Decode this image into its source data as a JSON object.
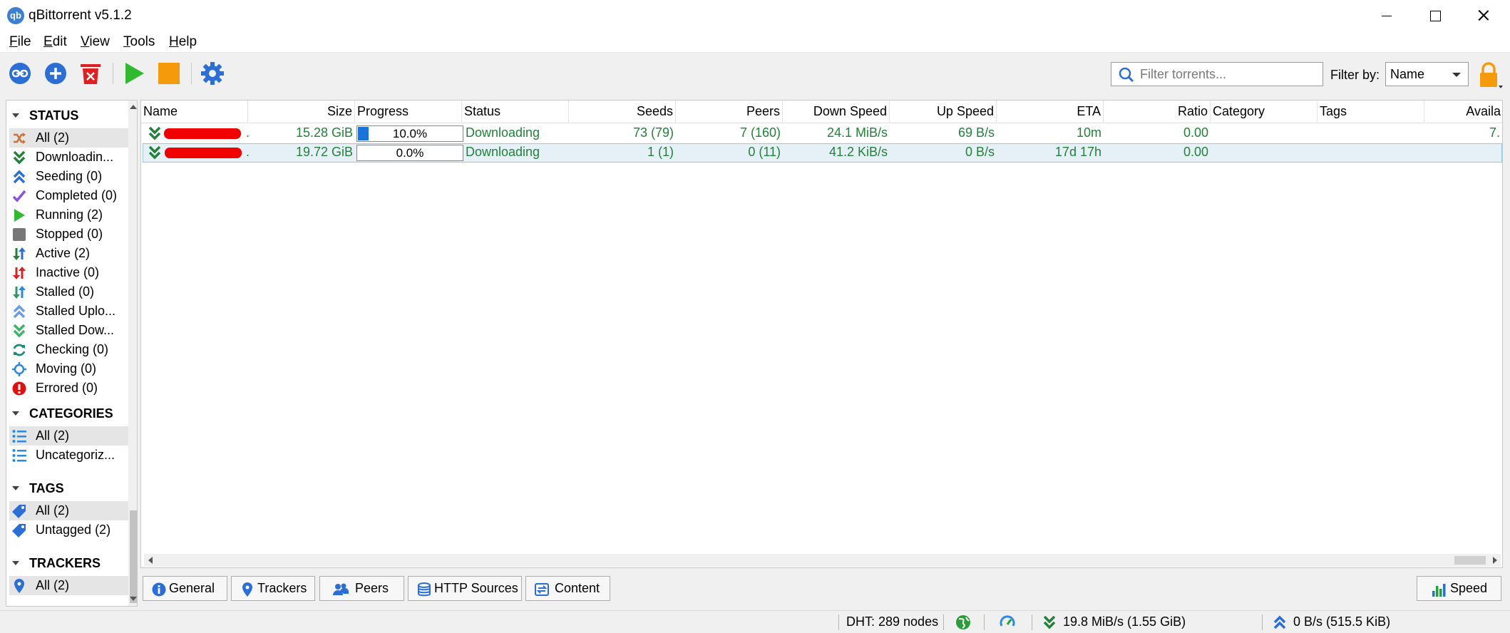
{
  "window": {
    "title": "qBittorrent v5.1.2",
    "app_icon_text": "qb"
  },
  "menu": [
    {
      "label": "File",
      "accel": "F",
      "rest": "ile"
    },
    {
      "label": "Edit",
      "accel": "E",
      "rest": "dit"
    },
    {
      "label": "View",
      "accel": "V",
      "rest": "iew"
    },
    {
      "label": "Tools",
      "accel": "T",
      "rest": "ools"
    },
    {
      "label": "Help",
      "accel": "H",
      "rest": "elp"
    }
  ],
  "toolbar": {
    "filter_placeholder": "Filter torrents...",
    "filter_by_label": "Filter by:",
    "filter_by_value": "Name",
    "icons": [
      "add-link-icon",
      "add-torrent-icon",
      "remove-torrent-icon",
      "start-icon",
      "stop-icon",
      "settings-icon",
      "lock-icon"
    ]
  },
  "sidebar": {
    "status": {
      "header": "STATUS",
      "items": [
        {
          "label": "All (2)",
          "icon": "shuffle-icon",
          "color": "#c8733a"
        },
        {
          "label": "Downloadin...",
          "icon": "download-icon",
          "color": "#23813a"
        },
        {
          "label": "Seeding (0)",
          "icon": "upload-icon",
          "color": "#2b6ed6"
        },
        {
          "label": "Completed (0)",
          "icon": "check-icon",
          "color": "#8a4ee0"
        },
        {
          "label": "Running (2)",
          "icon": "play-icon",
          "color": "#2fba2f"
        },
        {
          "label": "Stopped (0)",
          "icon": "stop-icon",
          "color": "#777777"
        },
        {
          "label": "Active (2)",
          "icon": "active-arrows-icon",
          "color": "#23813a"
        },
        {
          "label": "Inactive (0)",
          "icon": "inactive-arrows-icon",
          "color": "#e02020"
        },
        {
          "label": "Stalled (0)",
          "icon": "stalled-arrows-icon",
          "color": "#2b9a6a"
        },
        {
          "label": "Stalled Uplo...",
          "icon": "stalled-upload-icon",
          "color": "#6a9ce8"
        },
        {
          "label": "Stalled Dow...",
          "icon": "stalled-download-icon",
          "color": "#3fb36a"
        },
        {
          "label": "Checking (0)",
          "icon": "checking-icon",
          "color": "#1a8a7a"
        },
        {
          "label": "Moving (0)",
          "icon": "moving-icon",
          "color": "#2b8ae0"
        },
        {
          "label": "Errored (0)",
          "icon": "error-icon",
          "color": "#e01010"
        }
      ]
    },
    "categories": {
      "header": "CATEGORIES",
      "items": [
        {
          "label": "All (2)",
          "icon": "list-icon"
        },
        {
          "label": "Uncategoriz...",
          "icon": "list-icon"
        }
      ]
    },
    "tags": {
      "header": "TAGS",
      "items": [
        {
          "label": "All (2)",
          "icon": "tag-icon"
        },
        {
          "label": "Untagged (2)",
          "icon": "tag-icon"
        }
      ]
    },
    "trackers": {
      "header": "TRACKERS",
      "items": [
        {
          "label": "All (2)",
          "icon": "pin-icon"
        }
      ]
    }
  },
  "table": {
    "columns": [
      "Name",
      "Size",
      "Progress",
      "Status",
      "Seeds",
      "Peers",
      "Down Speed",
      "Up Speed",
      "ETA",
      "Ratio",
      "Category",
      "Tags",
      "Availa"
    ],
    "rows": [
      {
        "name_tail": ".",
        "size": "15.28 GiB",
        "progress": 0.1,
        "progress_text": "10.0%",
        "status": "Downloading",
        "seeds": "73 (79)",
        "peers": "7 (160)",
        "down": "24.1 MiB/s",
        "up": "69 B/s",
        "eta": "10m",
        "ratio": "0.00",
        "category": "",
        "tags": "",
        "avail": "7."
      },
      {
        "name_tail": ".",
        "size": "19.72 GiB",
        "progress": 0.0,
        "progress_text": "0.0%",
        "status": "Downloading",
        "seeds": "1 (1)",
        "peers": "0 (11)",
        "down": "41.2 KiB/s",
        "up": "0 B/s",
        "eta": "17d 17h",
        "ratio": "0.00",
        "category": "",
        "tags": "",
        "avail": ""
      }
    ]
  },
  "tabs": [
    {
      "label": "General",
      "icon": "info-icon"
    },
    {
      "label": "Trackers",
      "icon": "pin-icon"
    },
    {
      "label": "Peers",
      "icon": "people-icon"
    },
    {
      "label": "HTTP Sources",
      "icon": "database-icon"
    },
    {
      "label": "Content",
      "icon": "content-icon"
    }
  ],
  "speed_button": {
    "label": "Speed",
    "icon": "bar-chart-icon"
  },
  "statusbar": {
    "dht": "DHT: 289 nodes",
    "download": "19.8 MiB/s (1.55 GiB)",
    "upload": "0 B/s (515.5 KiB)"
  }
}
